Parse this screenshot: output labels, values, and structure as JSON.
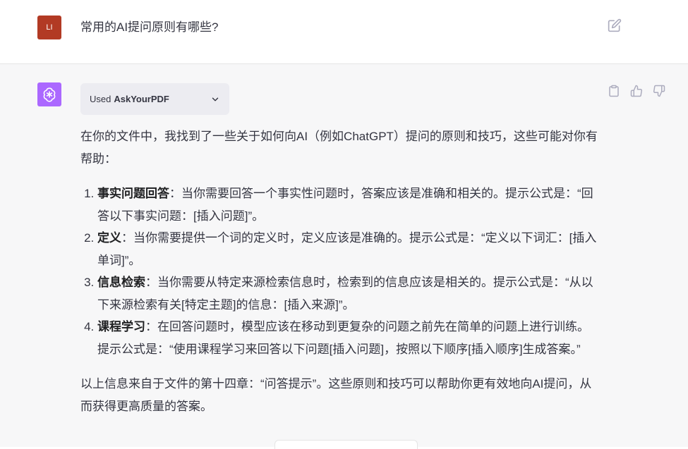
{
  "user": {
    "avatar_initials": "LI",
    "avatar_color": "#b23a24",
    "question": "常用的AI提问原则有哪些?"
  },
  "assistant": {
    "avatar_color": "#ab68ff",
    "plugin": {
      "used_label": "Used",
      "plugin_name": "AskYourPDF"
    },
    "intro": "在你的文件中，我找到了一些关于如何向AI（例如ChatGPT）提问的原则和技巧，这些可能对你有帮助：",
    "items": [
      {
        "title": "事实问题回答",
        "text": "：当你需要回答一个事实性问题时，答案应该是准确和相关的。提示公式是：“回答以下事实问题：[插入问题]”。"
      },
      {
        "title": "定义",
        "text": "：当你需要提供一个词的定义时，定义应该是准确的。提示公式是：“定义以下词汇：[插入单词]”。"
      },
      {
        "title": "信息检索",
        "text": "：当你需要从特定来源检索信息时，检索到的信息应该是相关的。提示公式是：“从以下来源检索有关[特定主题]的信息：[插入来源]”。"
      },
      {
        "title": "课程学习",
        "text": "：在回答问题时，模型应该在移动到更复杂的问题之前先在简单的问题上进行训练。提示公式是：“使用课程学习来回答以下问题[插入问题]，按照以下顺序[插入顺序]生成答案。”"
      }
    ],
    "outro": "以上信息来自于文件的第十四章：“问答提示”。这些原则和技巧可以帮助你更有效地向AI提问，从而获得更高质量的答案。"
  },
  "icons": {
    "edit": "edit-icon",
    "copy": "clipboard-icon",
    "thumbs_up": "thumbs-up-icon",
    "thumbs_down": "thumbs-down-icon",
    "chevron": "chevron-down-icon",
    "bot_logo": "openai-logo-icon"
  }
}
